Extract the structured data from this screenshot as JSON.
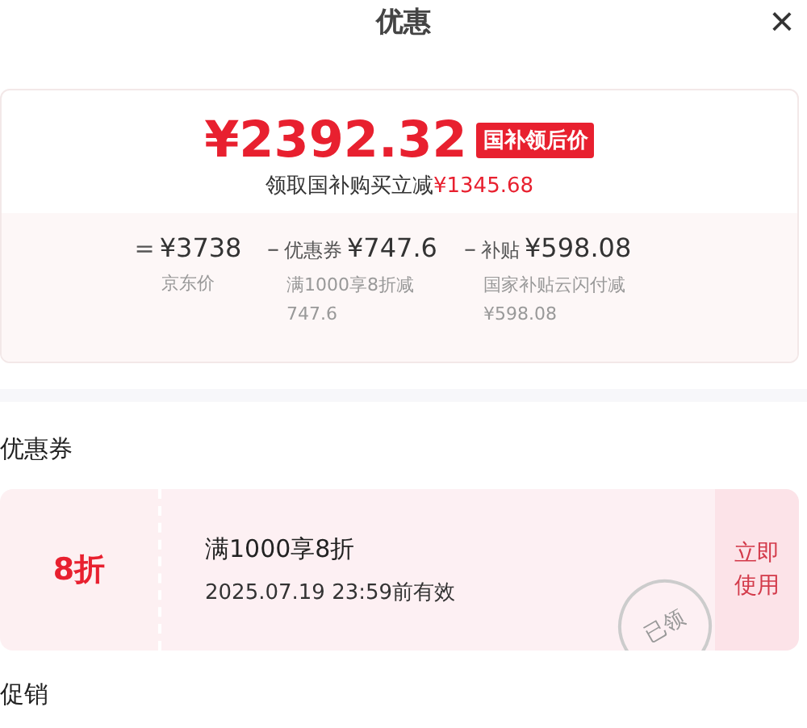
{
  "header": {
    "title": "优惠",
    "close": "×"
  },
  "price_card": {
    "price": "¥2392.32",
    "price_tag": "国补领后价",
    "saving_text": "领取国补购买立减**¥1345.68**",
    "breakdown": [
      {
        "op": "=",
        "amount": "¥3738",
        "note": "京东价"
      },
      {
        "op": "–",
        "label": "优惠券",
        "amount": "¥747.6",
        "note": "满1000享8折减747.6"
      },
      {
        "op": "–",
        "label": "补贴",
        "amount": "¥598.08",
        "note": "国家补贴云闪付减¥598.08"
      }
    ]
  },
  "coupons": {
    "heading": "优惠券",
    "items": [
      {
        "value": "8折",
        "title": "满1000享8折",
        "validity": "2025.07.19 23:59前有效",
        "stamp": "已领",
        "action": "立即使用"
      }
    ]
  },
  "promotions": {
    "heading": "促销"
  }
}
